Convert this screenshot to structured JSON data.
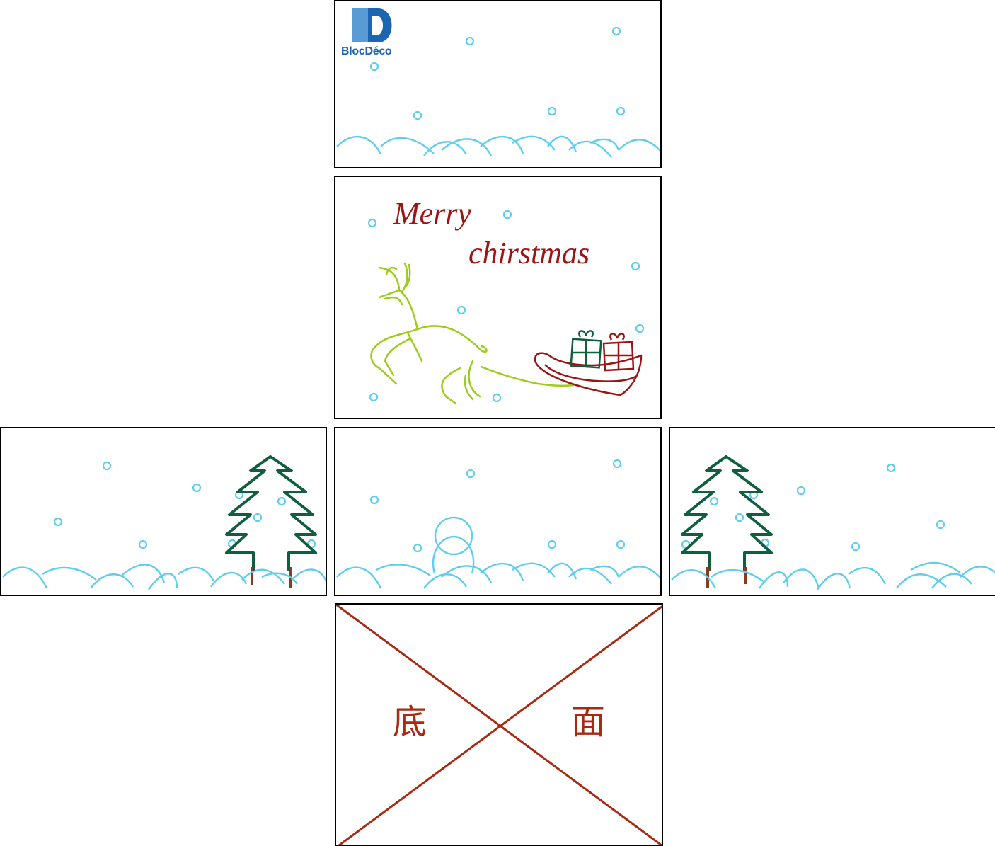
{
  "top_panel": {
    "logo": {
      "mark": "BD",
      "wordmark": "BlocDéco",
      "colors": [
        "#5b9bd5",
        "#1a66b3"
      ]
    }
  },
  "front_panel": {
    "greeting_line1": "Merry",
    "greeting_line2": "chirstmas",
    "greeting_color": "#9c1515",
    "illustration": [
      "reindeer-icon",
      "sleigh-icon",
      "gift-box-icon"
    ]
  },
  "side_panels": {
    "illustration": [
      "christmas-tree-icon",
      "snowman-icon",
      "snowflake-icon"
    ]
  },
  "bottom_panel": {
    "label_left": "底",
    "label_right": "面",
    "cross_color": "#a82a12"
  },
  "colors": {
    "snow": "#5fcdee",
    "tree": "#0f5f3e",
    "reindeer": "#9ccc1a",
    "sleigh": "#9c1515"
  }
}
